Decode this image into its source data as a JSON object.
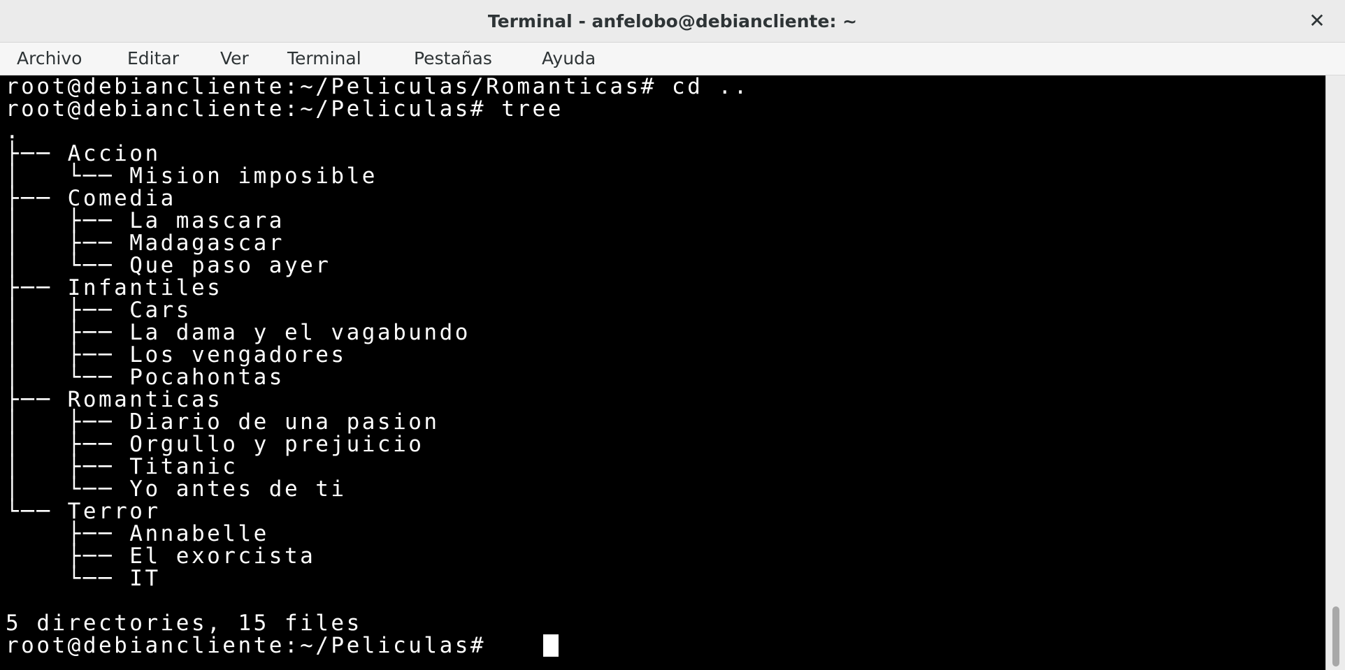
{
  "window": {
    "title": "Terminal - anfelobo@debiancliente: ~",
    "close_icon": "close-icon",
    "close_glyph": "✕"
  },
  "menubar": {
    "items": [
      "Archivo",
      "Editar",
      "Ver",
      "Terminal",
      "Pestañas",
      "Ayuda"
    ]
  },
  "terminal": {
    "lines": [
      "root@debiancliente:~/Peliculas/Romanticas# cd ..",
      "root@debiancliente:~/Peliculas# tree",
      ".",
      "├── Accion",
      "│   └── Mision imposible",
      "├── Comedia",
      "│   ├── La mascara",
      "│   ├── Madagascar",
      "│   └── Que paso ayer",
      "├── Infantiles",
      "│   ├── Cars",
      "│   ├── La dama y el vagabundo",
      "│   ├── Los vengadores",
      "│   └── Pocahontas",
      "├── Romanticas",
      "│   ├── Diario de una pasion",
      "│   ├── Orgullo y prejuicio",
      "│   ├── Titanic",
      "│   └── Yo antes de ti",
      "└── Terror",
      "    ├── Annabelle",
      "    ├── El exorcista",
      "    └── IT",
      "",
      "5 directories, 15 files",
      "root@debiancliente:~/Peliculas# "
    ],
    "background": "#000000",
    "foreground": "#ffffff"
  }
}
